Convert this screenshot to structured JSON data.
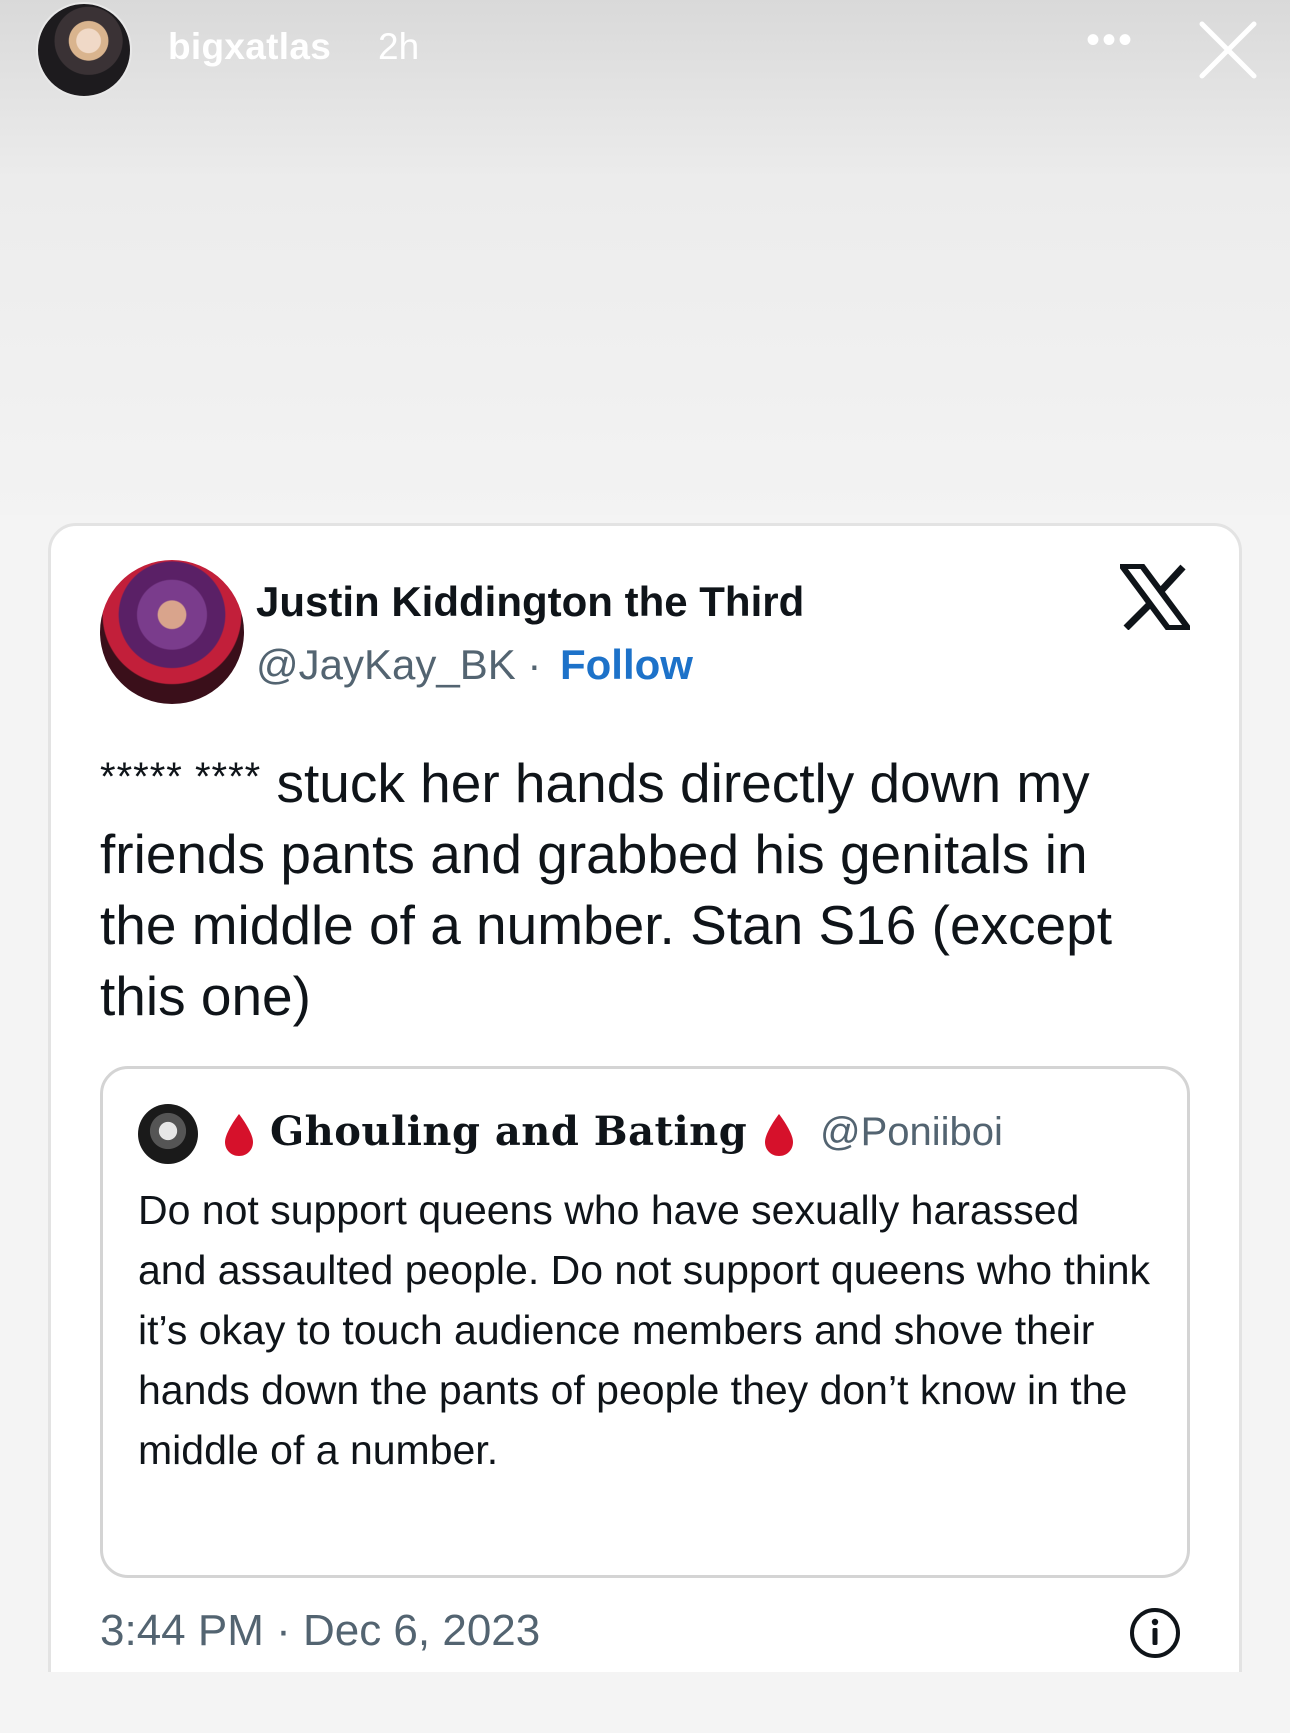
{
  "story": {
    "username": "bigxatlas",
    "time_ago": "2h",
    "more_label": "•••"
  },
  "tweet": {
    "author_name": "Justin Kiddington the Third",
    "author_handle": "@JayKay_BK",
    "separator": " · ",
    "follow_label": "Follow",
    "censored": "***** ****",
    "text": " stuck her hands directly down my friends pants and grabbed his genitals in the middle of a number. Stan S16 (except this one)",
    "timestamp": "3:44 PM · Dec 6, 2023"
  },
  "quote": {
    "display_name": "Ghouling and Bating",
    "handle": "@Poniiboi",
    "text": "Do not support queens who have sexually harassed and assaulted people. Do not support queens who think it’s okay to touch audience members and shove their hands down the pants of people they don’t know in the middle of a number."
  },
  "icons": {
    "close": "close-icon",
    "more": "more-icon",
    "x_logo": "x-logo-icon",
    "blood_drop": "blood-drop-icon",
    "info": "info-icon"
  },
  "colors": {
    "follow": "#1d72c9",
    "handle_gray": "#536471",
    "blood_drop": "#d6112b",
    "text": "#0f1419"
  }
}
